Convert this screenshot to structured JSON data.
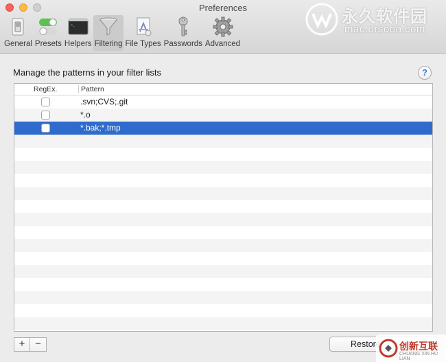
{
  "window": {
    "title": "Preferences"
  },
  "toolbar": {
    "items": [
      {
        "label": "General",
        "icon": "switch-icon"
      },
      {
        "label": "Presets",
        "icon": "toggles-icon"
      },
      {
        "label": "Helpers",
        "icon": "terminal-icon"
      },
      {
        "label": "Filtering",
        "icon": "funnel-icon",
        "selected": true
      },
      {
        "label": "File Types",
        "icon": "app-doc-icon"
      },
      {
        "label": "Passwords",
        "icon": "key-icon"
      },
      {
        "label": "Advanced",
        "icon": "gear-icon"
      }
    ]
  },
  "filter": {
    "heading": "Manage the patterns in your filter lists",
    "help_label": "?",
    "columns": {
      "regex": "RegEx.",
      "pattern": "Pattern"
    },
    "rows": [
      {
        "regex": false,
        "pattern": ".svn;CVS;.git",
        "selected": false
      },
      {
        "regex": false,
        "pattern": "*.o",
        "selected": false
      },
      {
        "regex": false,
        "pattern": "*.bak;*.tmp",
        "selected": true
      }
    ]
  },
  "buttons": {
    "add": "+",
    "remove": "−",
    "restore": "Restore"
  },
  "watermarks": {
    "top_cn": "永久软件园",
    "top_url": "mac.orsoon.com",
    "bottom_cn": "创新互联",
    "bottom_en": "CHUANG XIN HU LIAN"
  },
  "colors": {
    "selection": "#2f6bcd",
    "close": "#fc605c",
    "minimize": "#fdbc40"
  }
}
